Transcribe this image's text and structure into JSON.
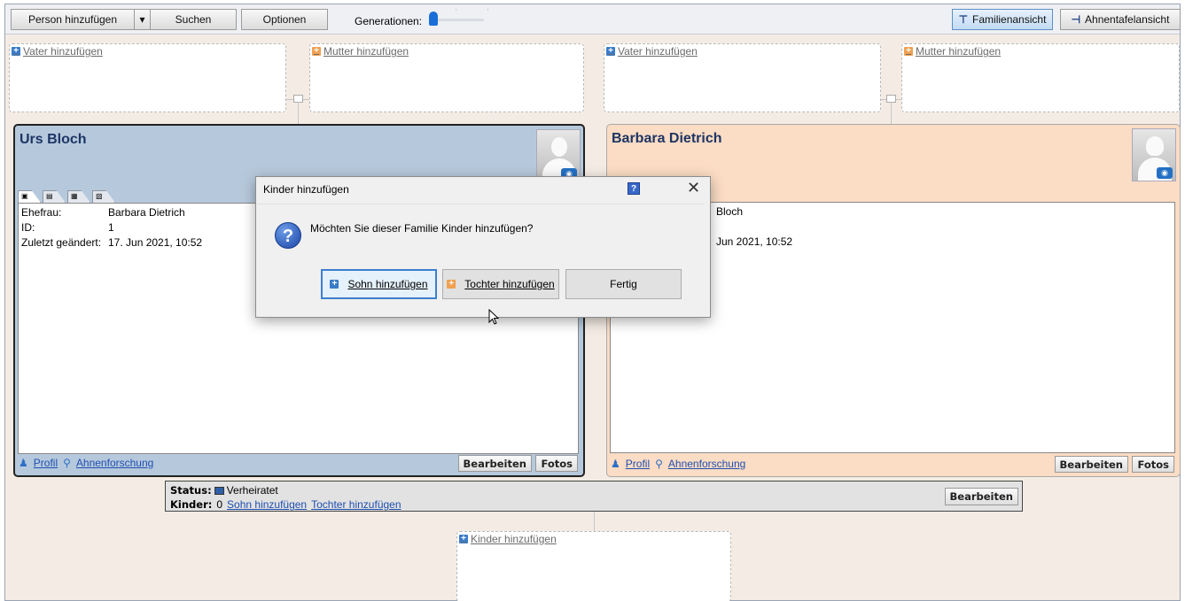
{
  "toolbar": {
    "add_person": "Person hinzufügen",
    "dropdown_glyph": "▾",
    "search": "Suchen",
    "options": "Optionen",
    "generations_label": "Generationen:",
    "family_view": "Familienansicht",
    "pedigree_view": "Ahnentafelansicht"
  },
  "parents": {
    "left_father": "Vater hinzufügen",
    "left_mother": "Mutter hinzufügen",
    "right_father": "Vater hinzufügen",
    "right_mother": "Mutter hinzufügen"
  },
  "husband": {
    "name": "Urs Bloch",
    "rows": [
      {
        "k": "Ehefrau:",
        "v": "Barbara Dietrich"
      },
      {
        "k": "ID:",
        "v": "1"
      },
      {
        "k": "Zuletzt geändert:",
        "v": "17. Jun 2021, 10:52"
      }
    ]
  },
  "wife": {
    "name": "Barbara Dietrich",
    "rows": [
      {
        "v": "Bloch"
      },
      {
        "v": "Jun 2021, 10:52"
      }
    ]
  },
  "card_footer": {
    "profile": "Profil",
    "research": "Ahnenforschung",
    "edit": "Bearbeiten",
    "photos": "Fotos"
  },
  "status": {
    "status_label": "Status:",
    "status_value": "Verheiratet",
    "children_label": "Kinder:",
    "children_count": "0",
    "add_son": "Sohn hinzufügen",
    "add_daughter": "Tochter hinzufügen",
    "edit": "Bearbeiten"
  },
  "children_box": {
    "add_children": "Kinder hinzufügen"
  },
  "dialog": {
    "title": "Kinder hinzufügen",
    "help": "?",
    "close": "✕",
    "message": "Möchten Sie dieser Familie Kinder hinzufügen?",
    "son_button": "Sohn hinzufügen",
    "daughter_button": "Tochter hinzufügen",
    "done_button": "Fertig"
  },
  "colors": {
    "male_card": "#b6c9dc",
    "female_card": "#fbdcc4",
    "background": "#f4ece4",
    "accent": "#3c7fd0"
  }
}
